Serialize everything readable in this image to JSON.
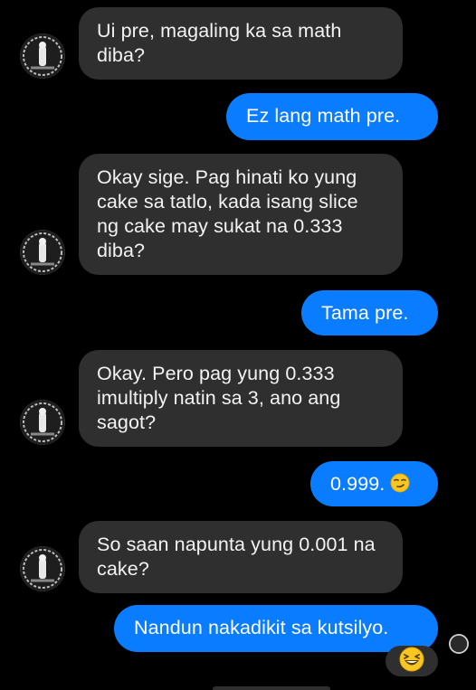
{
  "conversation": {
    "messages": [
      {
        "direction": "incoming",
        "text": "Ui pre, magaling ka sa math diba?"
      },
      {
        "direction": "outgoing",
        "text": "Ez lang math pre."
      },
      {
        "direction": "incoming",
        "text": "Okay sige. Pag hinati ko yung cake sa tatlo, kada isang slice ng cake may sukat na 0.333 diba?"
      },
      {
        "direction": "outgoing",
        "text": "Tama pre."
      },
      {
        "direction": "incoming",
        "text": "Okay. Pero pag yung 0.333 imultiply natin sa 3, ano ang sagot?"
      },
      {
        "direction": "outgoing",
        "text": "0.999.",
        "emoji": "smirk-face-icon"
      },
      {
        "direction": "incoming",
        "text": "So saan napunta yung 0.001 na cake?"
      },
      {
        "direction": "outgoing",
        "text": "Nandun nakadikit sa kutsilyo.",
        "reaction": "laughing-face-icon"
      }
    ]
  },
  "colors": {
    "background": "#000000",
    "incoming_bubble": "#2f2f2f",
    "outgoing_bubble": "#0a7cff",
    "text": "#ffffff"
  }
}
